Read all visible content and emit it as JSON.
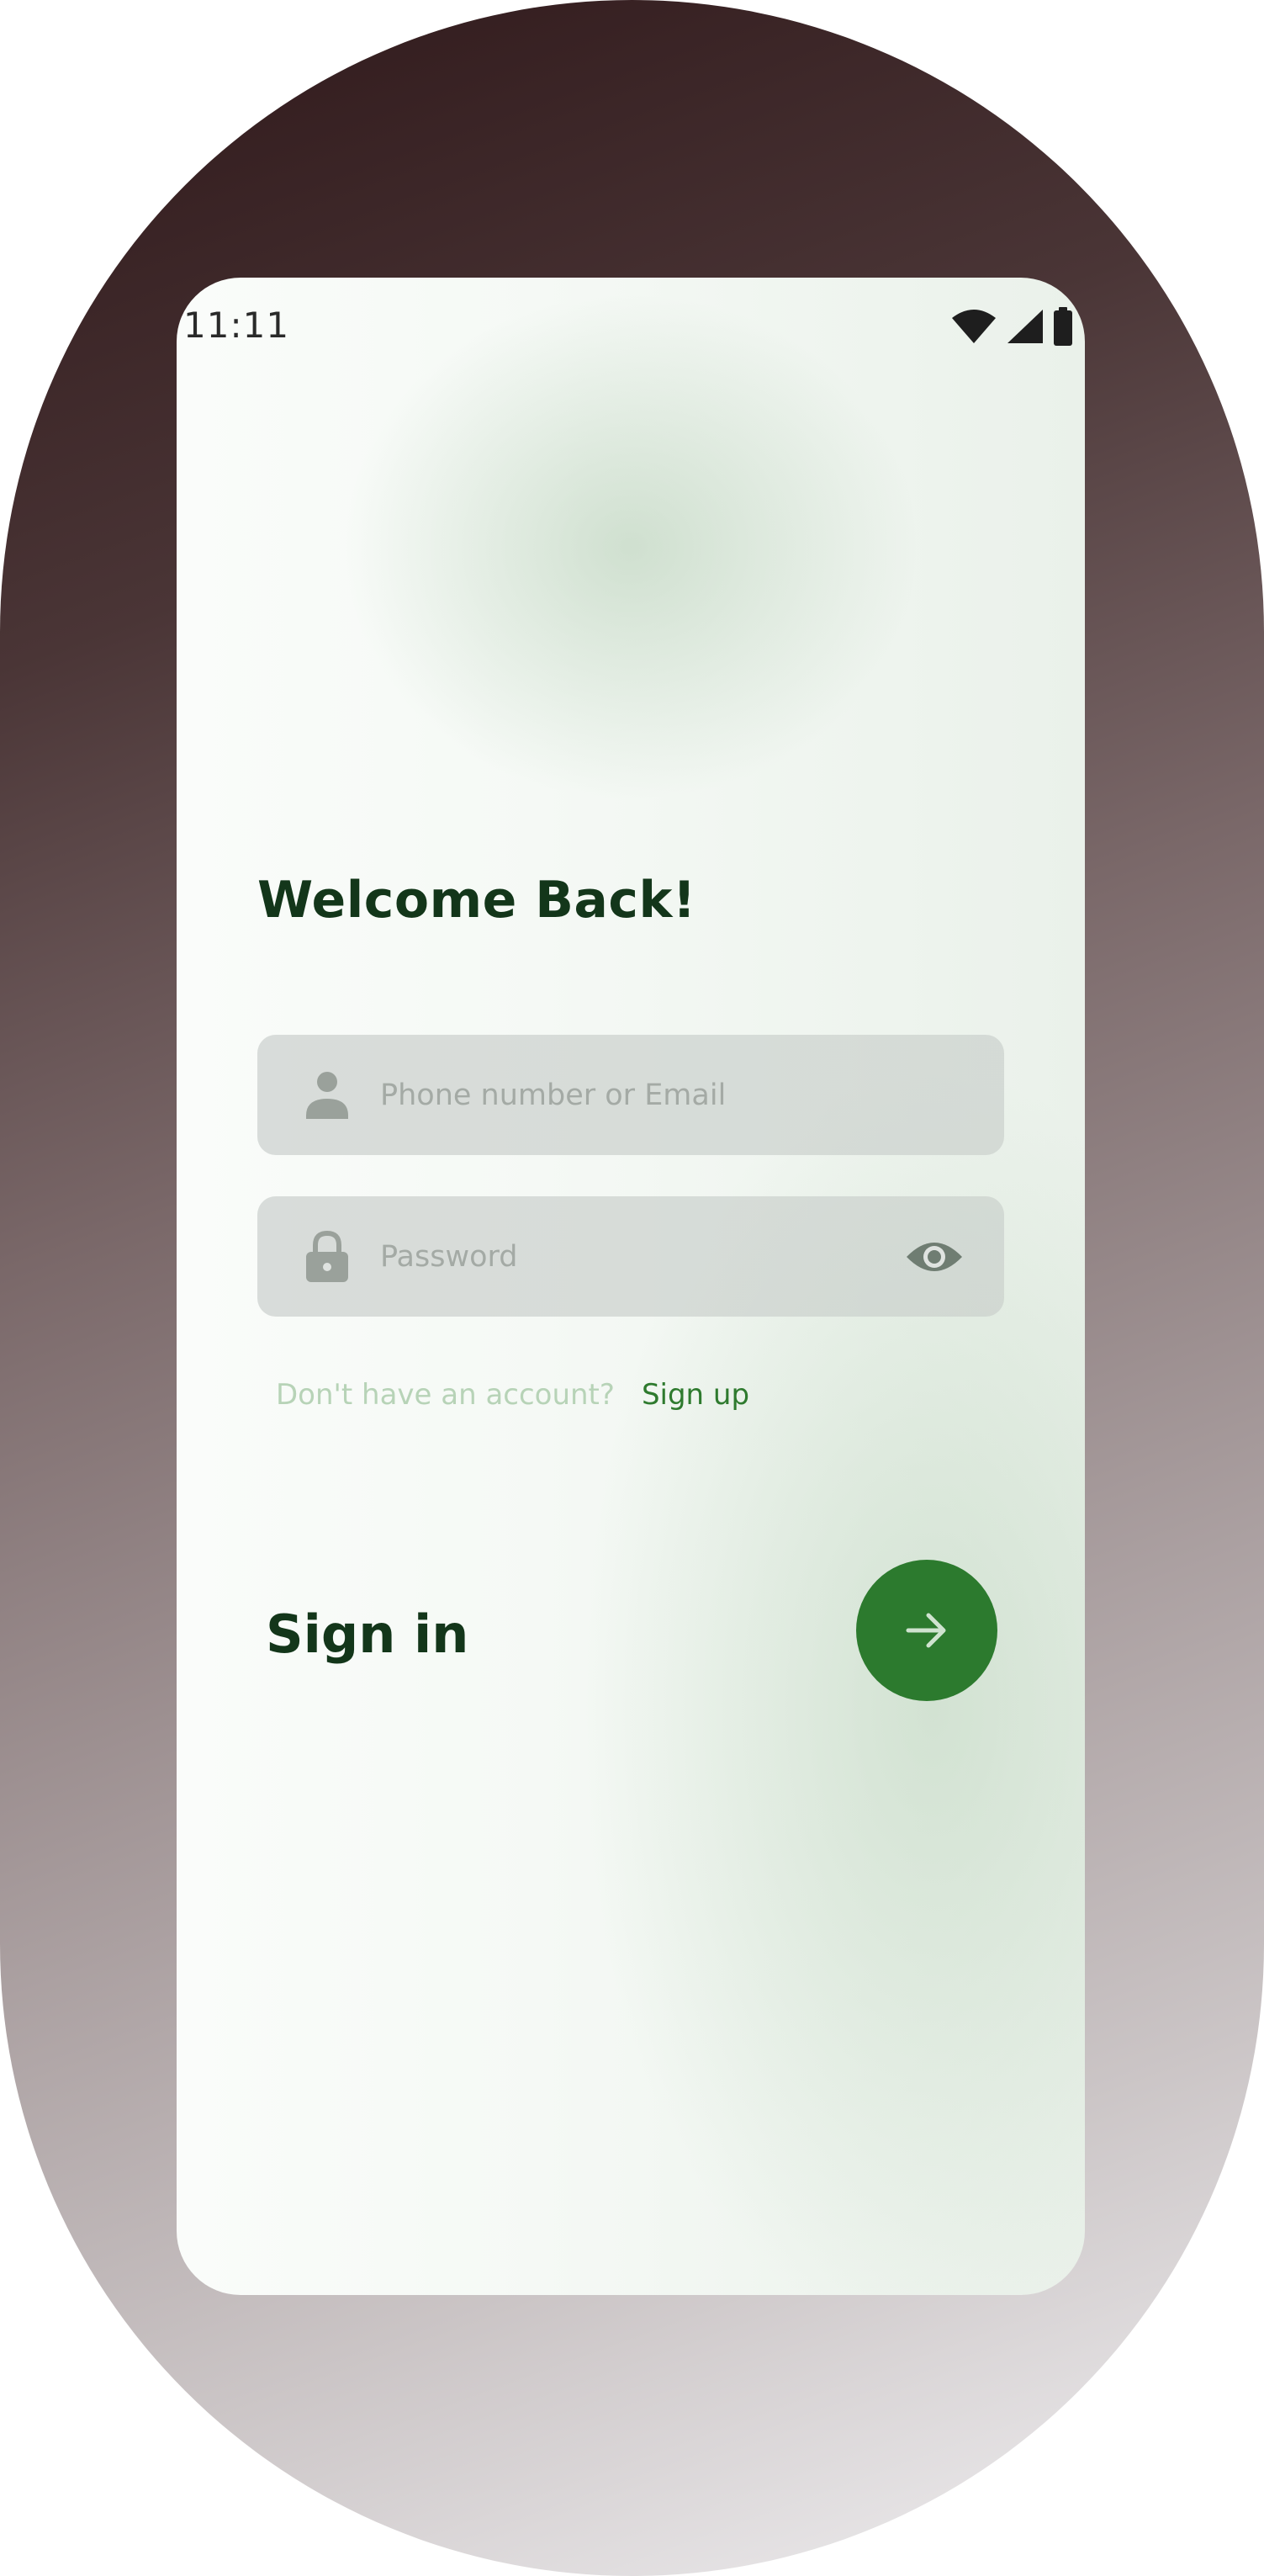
{
  "status_bar": {
    "time": "11:11",
    "icons": [
      "wifi-icon",
      "cellular-signal-icon",
      "battery-icon"
    ]
  },
  "login": {
    "title": "Welcome Back!",
    "email_field": {
      "placeholder": "Phone number or Email",
      "value": "",
      "icon": "person-icon"
    },
    "password_field": {
      "placeholder": "Password",
      "value": "",
      "icon": "lock-icon",
      "toggle_icon": "eye-icon"
    },
    "signup_prompt": "Don't have an account?",
    "signup_link": "Sign up",
    "signin_label": "Sign in",
    "signin_button_icon": "arrow-right-icon"
  },
  "colors": {
    "accent": "#2c7a2e",
    "heading": "#13361a",
    "prompt": "#b7d3b7",
    "link": "#2e7a2e",
    "field_background": "#cdd2cf"
  }
}
